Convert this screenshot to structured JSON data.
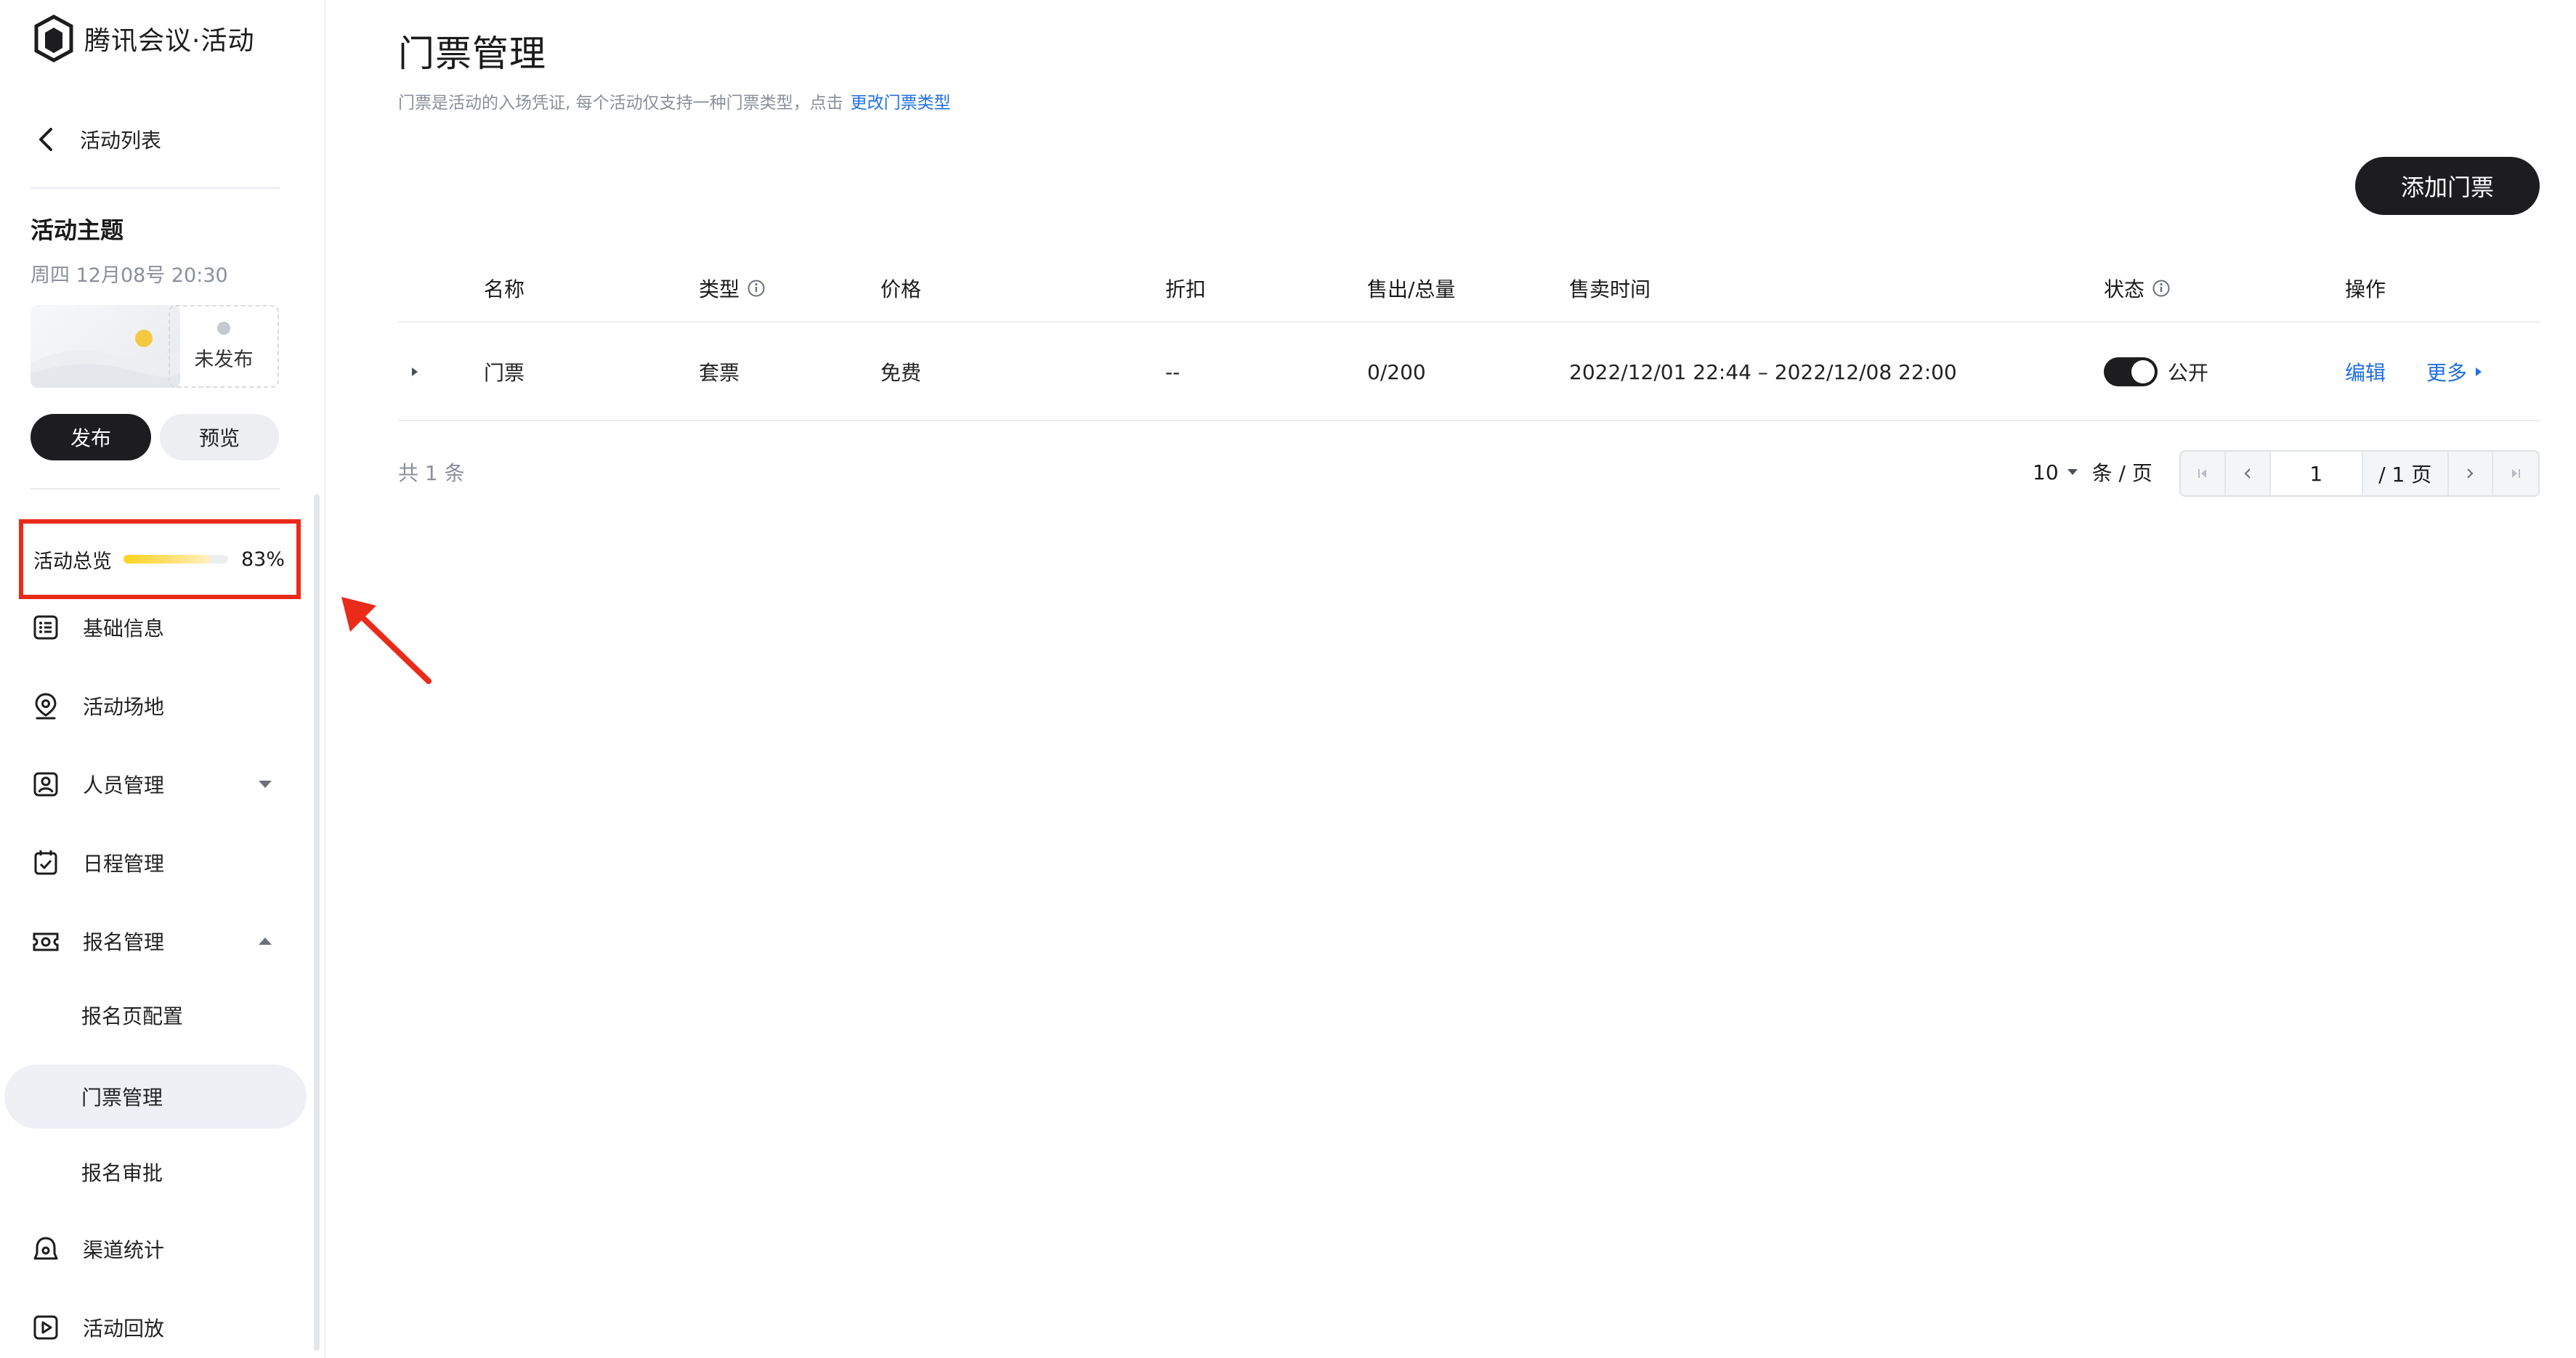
{
  "brand": {
    "name": "腾讯会议·活动"
  },
  "sidebar": {
    "back_label": "活动列表",
    "event": {
      "title": "活动主题",
      "time": "周四  12月08号  20:30",
      "status": "未发布"
    },
    "publish_label": "发布",
    "preview_label": "预览",
    "overview": {
      "label": "活动总览",
      "percent_text": "83%",
      "progress": 0.83
    },
    "nav": [
      {
        "label": "基础信息",
        "icon": "list-icon"
      },
      {
        "label": "活动场地",
        "icon": "location-pin-icon"
      },
      {
        "label": "人员管理",
        "icon": "person-card-icon",
        "caret": "down"
      },
      {
        "label": "日程管理",
        "icon": "calendar-check-icon"
      },
      {
        "label": "报名管理",
        "icon": "ticket-icon",
        "caret": "up"
      }
    ],
    "sub_items": [
      "报名页配置",
      "门票管理",
      "报名审批"
    ],
    "active_sub": "门票管理",
    "nav_bottom": [
      {
        "label": "渠道统计",
        "icon": "channel-icon"
      },
      {
        "label": "活动回放",
        "icon": "play-box-icon"
      }
    ]
  },
  "main": {
    "title": "门票管理",
    "description": "门票是活动的入场凭证, 每个活动仅支持一种门票类型，点击",
    "description_link": "更改门票类型",
    "add_button": "添加门票",
    "table": {
      "headers": {
        "name": "名称",
        "type": "类型",
        "price": "价格",
        "discount": "折扣",
        "sold": "售出/总量",
        "sale_time": "售卖时间",
        "status": "状态",
        "ops": "操作"
      },
      "rows": [
        {
          "name": "门票",
          "type": "套票",
          "price": "免费",
          "discount": "--",
          "sold": "0/200",
          "sale_time": "2022/12/01 22:44 – 2022/12/08 22:00",
          "status": "公开",
          "status_on": true,
          "edit": "编辑",
          "more": "更多"
        }
      ]
    },
    "pagination": {
      "total": "共  1  条",
      "page_size": "10",
      "page_size_unit": "条 / 页",
      "current_page": "1",
      "total_pages": "/ 1 页"
    }
  },
  "colors": {
    "accent": "#1f6fe5",
    "dark": "#1d1d1f",
    "highlight_box": "#ea2b1a",
    "progress": "#ffd21f"
  }
}
